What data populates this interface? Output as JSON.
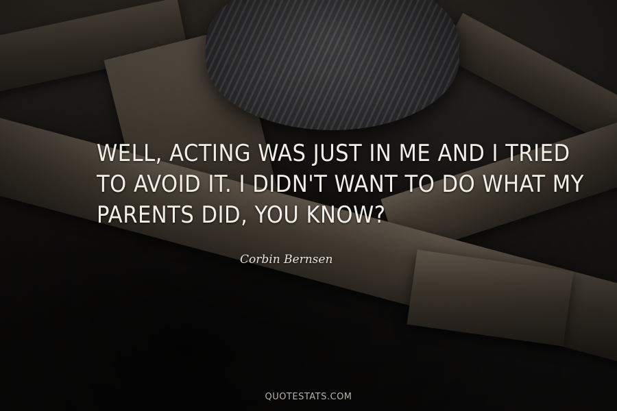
{
  "quote": {
    "lines": [
      "Well, acting was just in me and I tried",
      "to avoid it. I didn't want to do what my",
      "parents did, you know?"
    ],
    "author": "Corbin Bernsen"
  },
  "watermark": "QUOTESTATS.COM",
  "colors": {
    "text": "#f2efe9",
    "background": "#1c1a18"
  }
}
